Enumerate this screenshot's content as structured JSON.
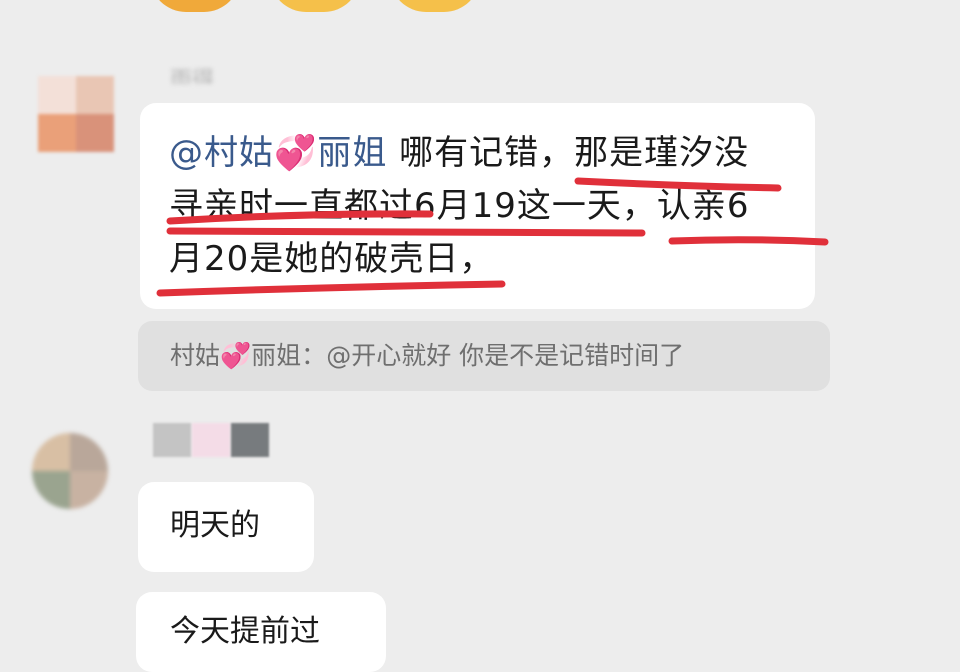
{
  "chat": {
    "top_emojis": [
      "smiley-emoji",
      "smiley-emoji",
      "smiley-emoji"
    ],
    "messages": [
      {
        "sender": "雨得",
        "mention": "@村姑",
        "mention_tail": "丽姐",
        "heart": "💞",
        "text_line1": "哪有记错，那是瑾汐没",
        "text_line2": "寻亲时一直都过6月19这一天，认亲6",
        "text_line3": "月20是她的破壳日，",
        "quote": {
          "author_head": "村姑",
          "author_tail": "丽姐",
          "heart": "💞",
          "separator": "：",
          "text": "@开心就好 你是不是记错时间了"
        }
      },
      {
        "text": "明天的"
      },
      {
        "text": "今天提前过"
      }
    ],
    "colors": {
      "background": "#ededed",
      "bubble": "#ffffff",
      "quote_bg": "#e0e0e0",
      "mention": "#3a5a8c",
      "underline": "#e0303a"
    }
  }
}
